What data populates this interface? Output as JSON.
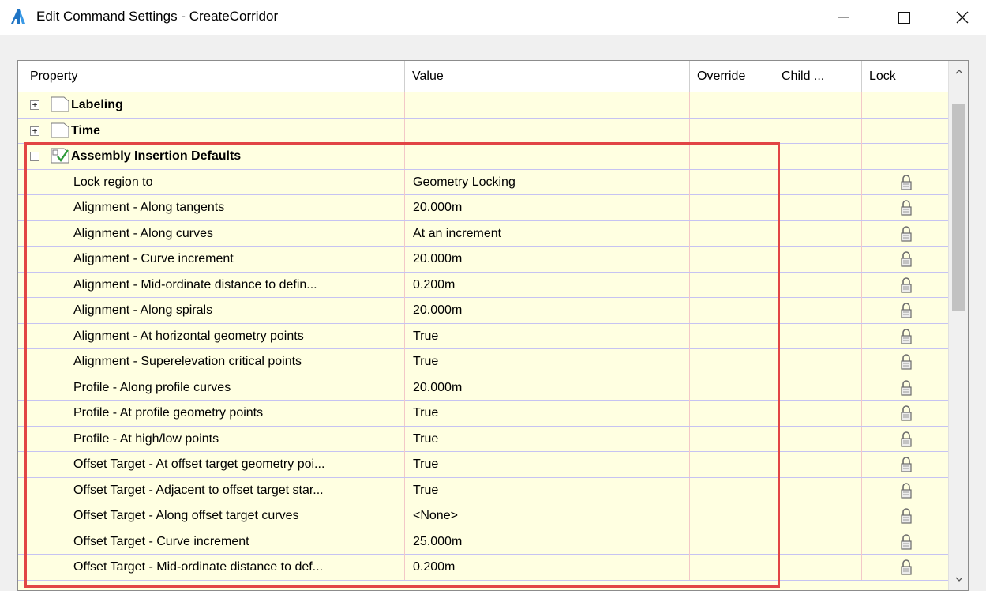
{
  "window": {
    "title": "Edit Command Settings - CreateCorridor",
    "icon": "autocad-a-icon",
    "controls": {
      "minimize": "—",
      "maximize": "☐",
      "close": "✕"
    }
  },
  "grid": {
    "columns": [
      "Property",
      "Value",
      "Override",
      "Child ...",
      "Lock"
    ],
    "categories": [
      {
        "label": "Labeling",
        "expanded": false
      },
      {
        "label": "Time",
        "expanded": false
      },
      {
        "label": "Assembly Insertion Defaults",
        "expanded": true
      }
    ],
    "rows": [
      {
        "property": "Lock region to",
        "value": "Geometry Locking"
      },
      {
        "property": "Alignment - Along tangents",
        "value": "20.000m"
      },
      {
        "property": "Alignment - Along curves",
        "value": "At an increment"
      },
      {
        "property": "Alignment - Curve increment",
        "value": "20.000m"
      },
      {
        "property": "Alignment - Mid-ordinate distance to defin...",
        "value": "0.200m"
      },
      {
        "property": "Alignment - Along spirals",
        "value": "20.000m"
      },
      {
        "property": "Alignment - At horizontal geometry points",
        "value": "True"
      },
      {
        "property": "Alignment - Superelevation critical points",
        "value": "True"
      },
      {
        "property": "Profile - Along profile curves",
        "value": "20.000m"
      },
      {
        "property": "Profile - At profile geometry points",
        "value": "True"
      },
      {
        "property": "Profile - At high/low points",
        "value": "True"
      },
      {
        "property": "Offset Target - At offset target geometry poi...",
        "value": "True"
      },
      {
        "property": "Offset Target - Adjacent to offset target star...",
        "value": "True"
      },
      {
        "property": "Offset Target - Along offset target curves",
        "value": "<None>"
      },
      {
        "property": "Offset Target - Curve increment",
        "value": "25.000m"
      },
      {
        "property": "Offset Target - Mid-ordinate distance to def...",
        "value": "0.200m"
      }
    ],
    "expander_symbols": {
      "collapsed": "+",
      "expanded": "−"
    }
  },
  "colors": {
    "grid_background": "#ffffe1",
    "highlight_border": "#e24545",
    "row_divider": "#c6c3f2",
    "column_divider": "#f3c8c8"
  }
}
